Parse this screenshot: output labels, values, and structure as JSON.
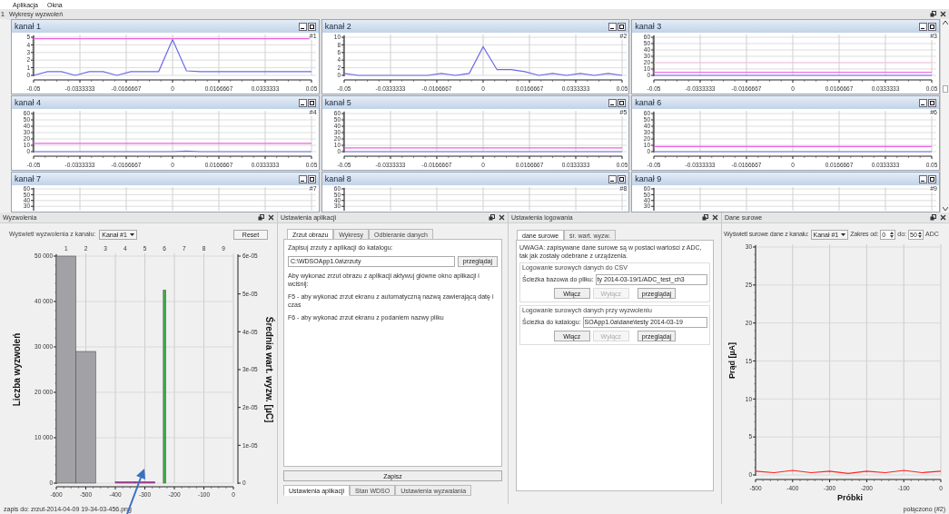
{
  "menu": [
    "Aplikacja",
    "Okna"
  ],
  "dock_index": "1",
  "plots_dock": {
    "title": "Wykresy wyzwoleń",
    "channels": [
      {
        "title": "kanał 1",
        "marker": "#1",
        "chart_data": {
          "type": "line",
          "grid": true,
          "x": [
            -0.05,
            -0.045,
            -0.04,
            -0.035,
            -0.03,
            -0.025,
            -0.02,
            -0.015,
            -0.01,
            -0.005,
            0,
            0.005,
            0.01,
            0.015,
            0.02,
            0.025,
            0.03,
            0.035,
            0.04,
            0.045,
            0.05
          ],
          "xlim": [
            -0.05,
            0.05
          ],
          "ylim": [
            0,
            5
          ],
          "xticks": [
            -0.05,
            -0.0333333,
            -0.0166667,
            0,
            0.0166667,
            0.0333333,
            0.05
          ],
          "yticks": [
            0,
            1,
            2,
            3,
            4,
            5
          ],
          "series": [
            {
              "color": "#6b6be6",
              "values": [
                0,
                0.5,
                0.5,
                0,
                0.5,
                0.5,
                0,
                0.5,
                0.5,
                0.5,
                4.7,
                0.6,
                0.5,
                0.5,
                0.5,
                0.5,
                0.5,
                0.5,
                0.5,
                0.5,
                0.5
              ]
            },
            {
              "color": "#f060e0",
              "values": [
                4.8,
                4.8,
                4.8,
                4.8,
                4.8,
                4.8,
                4.8,
                4.8,
                4.8,
                4.8,
                4.8,
                4.8,
                4.8,
                4.8,
                4.8,
                4.8,
                4.8,
                4.8,
                4.8,
                4.8,
                4.8
              ]
            }
          ]
        }
      },
      {
        "title": "kanał 2",
        "marker": "#2",
        "chart_data": {
          "type": "line",
          "grid": true,
          "x": [
            -0.05,
            -0.045,
            -0.04,
            -0.035,
            -0.03,
            -0.025,
            -0.02,
            -0.015,
            -0.01,
            -0.005,
            0,
            0.005,
            0.01,
            0.015,
            0.02,
            0.025,
            0.03,
            0.035,
            0.04,
            0.045,
            0.05
          ],
          "xlim": [
            -0.05,
            0.05
          ],
          "ylim": [
            0,
            10
          ],
          "xticks": [
            -0.05,
            -0.0333333,
            -0.0166667,
            0,
            0.0166667,
            0.0333333,
            0.05
          ],
          "yticks": [
            0,
            2,
            4,
            6,
            8,
            10
          ],
          "series": [
            {
              "color": "#6b6be6",
              "values": [
                0.5,
                0,
                0,
                0,
                0,
                0,
                0,
                0.5,
                0,
                0.5,
                7.5,
                1.5,
                1.5,
                1,
                0,
                0.5,
                0,
                0.5,
                0,
                0.5,
                0
              ]
            }
          ]
        }
      },
      {
        "title": "kanał 3",
        "marker": "#3",
        "chart_data": {
          "type": "line",
          "grid": true,
          "x": [
            -0.05,
            -0.045,
            -0.04,
            -0.035,
            -0.03,
            -0.025,
            -0.02,
            -0.015,
            -0.01,
            -0.005,
            0,
            0.005,
            0.01,
            0.015,
            0.02,
            0.025,
            0.03,
            0.035,
            0.04,
            0.045,
            0.05
          ],
          "xlim": [
            -0.05,
            0.05
          ],
          "ylim": [
            0,
            60
          ],
          "xticks": [
            -0.05,
            -0.0333333,
            -0.0166667,
            0,
            0.0166667,
            0.0333333,
            0.05
          ],
          "yticks": [
            0,
            10,
            20,
            30,
            40,
            50,
            60
          ],
          "series": [
            {
              "color": "#6b6be6",
              "values": [
                0,
                0,
                0,
                0,
                0,
                0,
                0,
                0,
                0,
                0,
                0,
                0,
                0,
                0,
                0,
                0,
                0,
                0,
                0,
                0,
                0
              ]
            },
            {
              "color": "#f060e0",
              "values": [
                5,
                5,
                5,
                5,
                5,
                5,
                5,
                5,
                5,
                5,
                5,
                5,
                5,
                5,
                5,
                5,
                5,
                5,
                5,
                5,
                5
              ]
            },
            {
              "color": "#f6c4ee",
              "values": [
                20,
                20,
                20,
                20,
                20,
                20,
                20,
                20,
                20,
                20,
                20,
                20,
                20,
                20,
                20,
                20,
                20,
                20,
                20,
                20,
                20
              ]
            }
          ]
        }
      },
      {
        "title": "kanał 4",
        "marker": "#4",
        "chart_data": {
          "type": "line",
          "grid": true,
          "x": [
            -0.05,
            -0.045,
            -0.04,
            -0.035,
            -0.03,
            -0.025,
            -0.02,
            -0.015,
            -0.01,
            -0.005,
            0,
            0.005,
            0.01,
            0.015,
            0.02,
            0.025,
            0.03,
            0.035,
            0.04,
            0.045,
            0.05
          ],
          "xlim": [
            -0.05,
            0.05
          ],
          "ylim": [
            0,
            60
          ],
          "xticks": [
            -0.05,
            -0.0333333,
            -0.0166667,
            0,
            0.0166667,
            0.0333333,
            0.05
          ],
          "yticks": [
            0,
            10,
            20,
            30,
            40,
            50,
            60
          ],
          "series": [
            {
              "color": "#6b6be6",
              "values": [
                0,
                0,
                0,
                0,
                0,
                0,
                0,
                0,
                0,
                0,
                0,
                1,
                0,
                0,
                0,
                0,
                0,
                0,
                0,
                0,
                0
              ]
            },
            {
              "color": "#f060e0",
              "values": [
                13,
                13,
                13,
                13,
                13,
                13,
                13,
                13,
                13,
                13,
                13,
                13,
                13,
                13,
                13,
                13,
                13,
                13,
                13,
                13,
                13
              ]
            }
          ]
        }
      },
      {
        "title": "kanał 5",
        "marker": "#5",
        "chart_data": {
          "type": "line",
          "grid": true,
          "x": [
            -0.05,
            -0.045,
            -0.04,
            -0.035,
            -0.03,
            -0.025,
            -0.02,
            -0.015,
            -0.01,
            -0.005,
            0,
            0.005,
            0.01,
            0.015,
            0.02,
            0.025,
            0.03,
            0.035,
            0.04,
            0.045,
            0.05
          ],
          "xlim": [
            -0.05,
            0.05
          ],
          "ylim": [
            0,
            60
          ],
          "xticks": [
            -0.05,
            -0.0333333,
            -0.0166667,
            0,
            0.0166667,
            0.0333333,
            0.05
          ],
          "yticks": [
            0,
            10,
            20,
            30,
            40,
            50,
            60
          ],
          "series": [
            {
              "color": "#6b6be6",
              "values": [
                0,
                0,
                0,
                0,
                0,
                0,
                0,
                0,
                0,
                0,
                0,
                0,
                0,
                0,
                0,
                0,
                0,
                0,
                0,
                0,
                0
              ]
            },
            {
              "color": "#f060e0",
              "values": [
                6,
                6,
                6,
                6,
                6,
                6,
                6,
                6,
                6,
                6,
                6,
                6,
                6,
                6,
                6,
                6,
                6,
                6,
                6,
                6,
                6
              ]
            }
          ]
        }
      },
      {
        "title": "kanał 6",
        "marker": "#6",
        "chart_data": {
          "type": "line",
          "grid": true,
          "x": [
            -0.05,
            -0.045,
            -0.04,
            -0.035,
            -0.03,
            -0.025,
            -0.02,
            -0.015,
            -0.01,
            -0.005,
            0,
            0.005,
            0.01,
            0.015,
            0.02,
            0.025,
            0.03,
            0.035,
            0.04,
            0.045,
            0.05
          ],
          "xlim": [
            -0.05,
            0.05
          ],
          "ylim": [
            0,
            60
          ],
          "xticks": [
            -0.05,
            -0.0333333,
            -0.0166667,
            0,
            0.0166667,
            0.0333333,
            0.05
          ],
          "yticks": [
            0,
            10,
            20,
            30,
            40,
            50,
            60
          ],
          "series": [
            {
              "color": "#6b6be6",
              "values": [
                0,
                0,
                0,
                0,
                0,
                0,
                0,
                0,
                0,
                0,
                0,
                0,
                0,
                0,
                0,
                0,
                0,
                0,
                0,
                0,
                0
              ]
            },
            {
              "color": "#f060e0",
              "values": [
                8,
                8,
                8,
                8,
                8,
                8,
                8,
                8,
                8,
                8,
                8,
                8,
                8,
                8,
                8,
                8,
                8,
                8,
                8,
                8,
                8
              ]
            }
          ]
        }
      },
      {
        "title": "kanał 7",
        "marker": "#7",
        "y_axis_labels": [
          "60",
          "50",
          "40",
          "30"
        ]
      },
      {
        "title": "kanał 8",
        "marker": "#8",
        "y_axis_labels": [
          "60",
          "50",
          "40",
          "30"
        ]
      },
      {
        "title": "kanał 9",
        "marker": "#9",
        "y_axis_labels": [
          "60",
          "50",
          "40",
          "30"
        ]
      }
    ]
  },
  "trigger_dock": {
    "title": "Wyzwolenia",
    "channel_label": "Wyświetl wyzwolenia z kanału:",
    "channel_select": "Kanał #1",
    "reset_button": "Reset",
    "top_axis_labels": [
      "1",
      "2",
      "3",
      "4",
      "5",
      "6",
      "7",
      "8",
      "9"
    ],
    "right_axis_labels": [
      "6e-05",
      "5e-05",
      "4e-05",
      "3e-05",
      "2e-05",
      "1e-05",
      "0"
    ],
    "chart_data": {
      "type": "bar",
      "grid": true,
      "ylabel": "Liczba wyzwoleń",
      "x": [
        -566.7,
        -500,
        -433.3,
        -366.7,
        -300,
        -233.3,
        -166.7,
        -100,
        -33.3
      ],
      "xlim": [
        -600,
        0
      ],
      "ylim": [
        0,
        50000
      ],
      "xticks": [
        -600,
        -500,
        -400,
        -300,
        -200,
        -100,
        0
      ],
      "yticks": [
        {
          "value": 0,
          "label": "0"
        },
        {
          "value": 10000,
          "label": "10 000"
        },
        {
          "value": 20000,
          "label": "20 000"
        },
        {
          "value": 30000,
          "label": "30 000"
        },
        {
          "value": 40000,
          "label": "40 000"
        },
        {
          "value": 50000,
          "label": "50 000"
        }
      ],
      "series": [
        {
          "color": "#a2a2a6",
          "values": [
            50000,
            29000,
            0,
            0,
            0,
            0,
            0,
            0,
            0
          ]
        },
        {
          "color": "#c02aa8",
          "values": [
            0,
            0,
            0,
            300,
            300,
            0,
            0,
            0,
            0
          ]
        },
        {
          "name": "Średnia wart. wyzw. [µC]",
          "color": "#3cb043",
          "values": [
            0,
            0,
            0,
            0,
            0,
            42500,
            0,
            0,
            0
          ]
        }
      ]
    }
  },
  "app_settings_dock": {
    "title": "Ustawienia aplikacji",
    "tabs": [
      {
        "label": "Zrzut obrazu",
        "selected": true
      },
      {
        "label": "Wykresy",
        "selected": false
      },
      {
        "label": "Odbieranie danych",
        "selected": false
      }
    ],
    "folder_label": "Zapisuj zrzuty z aplikacji do katalogu:",
    "folder_value": "C:\\WDSOApp1.0a\\zrzuty",
    "browse_button": "przeglądaj",
    "notes": [
      "Aby wykonać zrzut obrazu z aplikacji aktywuj główne okno aplikacji i wciśnij:",
      "F5 - aby wykonać zrzut ekranu z automatyczną nazwą zawierającą datę i czas",
      "F6 - aby wykonać zrzut ekranu z podaniem nazwy pliku"
    ],
    "save_button": "Zapisz",
    "bottom_tabs": [
      {
        "label": "Ustawienia aplikacji",
        "selected": true
      },
      {
        "label": "Stan WDSO",
        "selected": false
      },
      {
        "label": "Ustawienia wyzwalania",
        "selected": false
      }
    ]
  },
  "logging_dock": {
    "title": "Ustawienia logowania",
    "tabs": [
      {
        "label": "dane surowe",
        "selected": true
      },
      {
        "label": "śr. wart. wyzw.",
        "selected": false
      }
    ],
    "note": "UWAGA: zapisywane dane surowe są w postaci wartości z ADC, tak jak zostały odebrane z urządzenia.",
    "groups": [
      {
        "title": "Logowanie surowych danych do CSV",
        "field_label": "Ścieżka bazowa do pliku:",
        "field_value": "ty 2014-03-19/1/ADC_test_ch3",
        "browse_button": "przeglądaj",
        "buttons": [
          {
            "label": "Włącz",
            "disabled": false
          },
          {
            "label": "Wyłącz",
            "disabled": true
          }
        ]
      },
      {
        "title": "Logowanie surowych danych przy wyzwoleniu",
        "field_label": "Ścieżka do katalogu:",
        "field_value": "SOApp1.0a\\dane\\testy 2014-03-19",
        "browse_button": "przeglądaj",
        "buttons": [
          {
            "label": "Włącz",
            "disabled": false
          },
          {
            "label": "Wyłącz",
            "disabled": true
          }
        ]
      }
    ]
  },
  "raw_dock": {
    "title": "Dane surowe",
    "channel_label": "Wyświetl surowe dane z kanału:",
    "channel_select": "Kanał #1",
    "range_from_label": "Zakres od:",
    "range_from": "0",
    "range_to_label": "do:",
    "range_to": "50",
    "unit": "ADC",
    "chart_data": {
      "type": "line",
      "grid": true,
      "xlabel": "Próbki",
      "ylabel": "Prąd [µA]",
      "x": [
        -500,
        -450,
        -400,
        -350,
        -300,
        -250,
        -200,
        -150,
        -100,
        -50,
        0
      ],
      "xlim": [
        -500,
        0
      ],
      "ylim": [
        0,
        30
      ],
      "xticks": [
        -500,
        -400,
        -300,
        -200,
        -100,
        0
      ],
      "yticks": [
        0,
        5,
        10,
        15,
        20,
        25,
        30
      ],
      "series": [
        {
          "color": "#ff2020",
          "values": [
            0.5,
            0.3,
            0.6,
            0.3,
            0.5,
            0.2,
            0.5,
            0.3,
            0.6,
            0.3,
            0.5
          ]
        }
      ]
    }
  },
  "status_bar": {
    "left": "zapis do: zrzut-2014-04-09 19-34-03-456.png",
    "right": "połączono (#2)"
  }
}
